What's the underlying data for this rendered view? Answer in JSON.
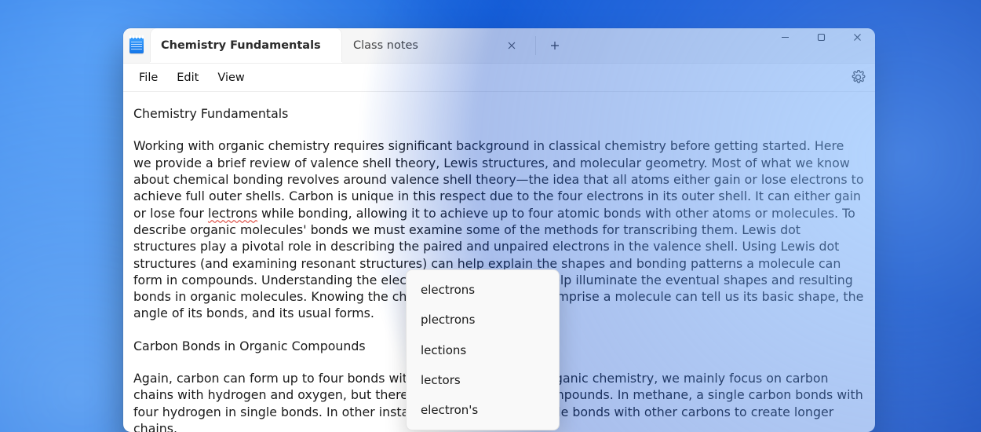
{
  "tabs": {
    "active": {
      "title": "Chemistry Fundamentals"
    },
    "inactive": {
      "title": "Class notes"
    }
  },
  "menu": {
    "file": "File",
    "edit": "Edit",
    "view": "View"
  },
  "document": {
    "heading": "Chemistry Fundamentals",
    "para1_a": "Working with organic chemistry requires significant background in classical chemistry before getting started. Here we provide a brief review of valence shell theory, Lewis structures, and molecular geometry. Most of what we know about chemical bonding revolves around valence shell theory—the idea that all atoms either gain or lose electrons to achieve full outer shells. Carbon is unique in this respect due to the four electrons in its outer shell. It can either gain or lose four ",
    "misspelled": "lectrons",
    "para1_b": " while bonding, allowing it to achieve up to four atomic bonds with other atoms or molecules. To describe organic molecules' bonds we must examine some of the methods for transcribing them. Lewis dot structures play a pivotal role in describing the paired and unpaired electrons in the valence shell. Using Lewis dot structures (and examining resonant structures) can help explain the shapes and bonding patterns a molecule can form in compounds. Understanding the electron orbital shells can help illuminate the eventual shapes and resulting bonds in organic molecules. Knowing the chemical elements that comprise a molecule can tell us its basic shape, the angle of its bonds, and its usual forms.",
    "subheading": "Carbon Bonds in Organic Compounds",
    "para2": "Again, carbon can form up to four bonds with other molecules. In organic chemistry, we mainly focus on carbon chains with hydrogen and oxygen, but there are infinite possible compounds. In methane, a single carbon bonds with four hydrogen in single bonds. In other instances, carbon forms single bonds with other carbons to create longer chains."
  },
  "spellcheck": {
    "suggestions": [
      "electrons",
      "plectrons",
      "lections",
      "lectors",
      "electron's"
    ]
  }
}
